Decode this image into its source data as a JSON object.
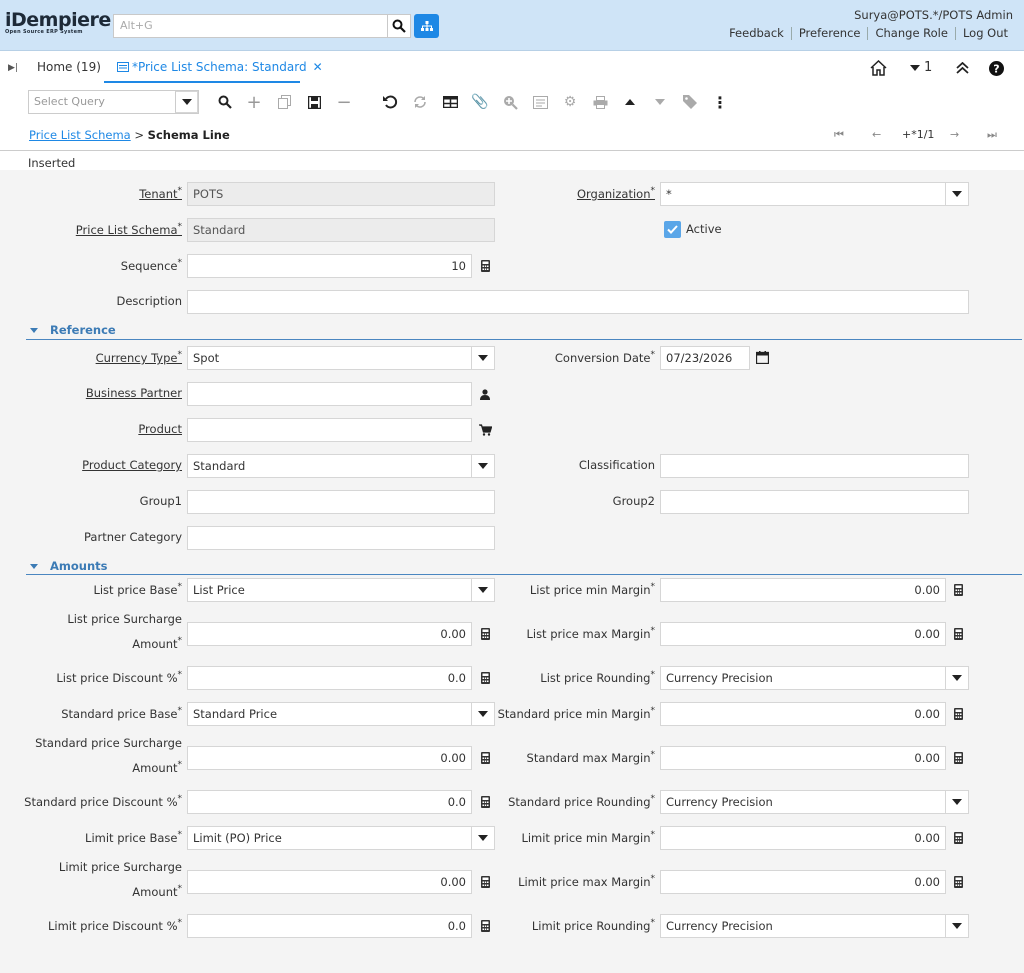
{
  "app": {
    "logo": "iDempiere",
    "logo_sub": "Open Source ERP System",
    "search_placeholder": "Alt+G",
    "user": "Surya@POTS.*/POTS Admin",
    "links": [
      "Feedback",
      "Preference",
      "Change Role",
      "Log Out"
    ]
  },
  "tabs": {
    "home": "Home (19)",
    "active": "*Price List Schema: Standard",
    "count": "1"
  },
  "toolbar": {
    "query_placeholder": "Select Query"
  },
  "breadcrumb": {
    "parent": "Price List Schema",
    "sep": ">",
    "current": "Schema Line",
    "record": "+*1/1"
  },
  "status": "Inserted",
  "fields": {
    "tenant": {
      "label": "Tenant",
      "value": "POTS"
    },
    "org": {
      "label": "Organization",
      "value": "*"
    },
    "schema": {
      "label": "Price List Schema",
      "value": "Standard"
    },
    "active": {
      "label": "Active"
    },
    "seq": {
      "label": "Sequence",
      "value": "10"
    },
    "desc": {
      "label": "Description",
      "value": ""
    },
    "currtype": {
      "label": "Currency Type",
      "value": "Spot"
    },
    "convdate": {
      "label": "Conversion Date",
      "value": "07/23/2026"
    },
    "bp": {
      "label": "Business Partner",
      "value": ""
    },
    "product": {
      "label": "Product",
      "value": ""
    },
    "prodcat": {
      "label": "Product Category",
      "value": "Standard"
    },
    "classification": {
      "label": "Classification",
      "value": ""
    },
    "group1": {
      "label": "Group1",
      "value": ""
    },
    "group2": {
      "label": "Group2",
      "value": ""
    },
    "partnercat": {
      "label": "Partner Category",
      "value": ""
    },
    "lp_base": {
      "label": "List price Base",
      "value": "List Price"
    },
    "lp_min": {
      "label": "List price min Margin",
      "value": "0.00"
    },
    "lp_sur": {
      "label1": "List price Surcharge",
      "label2": "Amount",
      "value": "0.00"
    },
    "lp_max": {
      "label": "List price max Margin",
      "value": "0.00"
    },
    "lp_disc": {
      "label": "List price Discount %",
      "value": "0.0"
    },
    "lp_round": {
      "label": "List price Rounding",
      "value": "Currency Precision"
    },
    "sp_base": {
      "label": "Standard price Base",
      "value": "Standard Price"
    },
    "sp_min": {
      "label": "Standard price min Margin",
      "value": "0.00"
    },
    "sp_sur": {
      "label1": "Standard price Surcharge",
      "label2": "Amount",
      "value": "0.00"
    },
    "sp_max": {
      "label": "Standard max Margin",
      "value": "0.00"
    },
    "sp_disc": {
      "label": "Standard price Discount %",
      "value": "0.0"
    },
    "sp_round": {
      "label": "Standard price Rounding",
      "value": "Currency Precision"
    },
    "lm_base": {
      "label": "Limit price Base",
      "value": "Limit (PO) Price"
    },
    "lm_min": {
      "label": "Limit price min Margin",
      "value": "0.00"
    },
    "lm_sur": {
      "label1": "Limit price Surcharge",
      "label2": "Amount",
      "value": "0.00"
    },
    "lm_max": {
      "label": "Limit price max Margin",
      "value": "0.00"
    },
    "lm_disc": {
      "label": "Limit price Discount %",
      "value": "0.0"
    },
    "lm_round": {
      "label": "Limit price Rounding",
      "value": "Currency Precision"
    }
  },
  "sections": {
    "reference": "Reference",
    "amounts": "Amounts"
  }
}
